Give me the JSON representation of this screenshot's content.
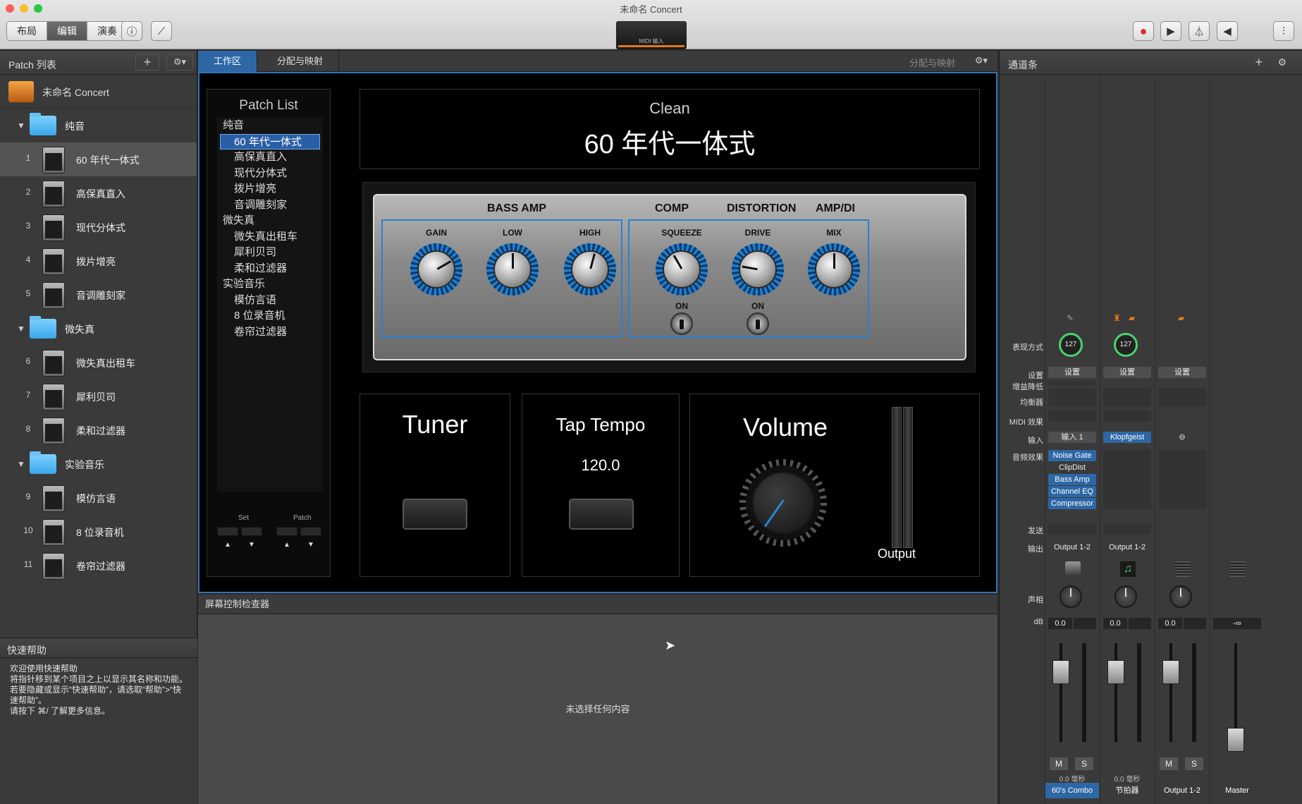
{
  "window": {
    "title": "未命名 Concert"
  },
  "toolbar": {
    "segments": [
      "布局",
      "编辑",
      "演奏"
    ],
    "selected": "编辑",
    "midi_display": "MIDI 输入"
  },
  "left_panel": {
    "title": "Patch 列表",
    "concert_name": "未命名 Concert",
    "sets": [
      {
        "name": "纯音",
        "patches": [
          {
            "num": "1",
            "name": "60 年代一体式"
          },
          {
            "num": "2",
            "name": "高保真直入"
          },
          {
            "num": "3",
            "name": "现代分体式"
          },
          {
            "num": "4",
            "name": "拨片增亮"
          },
          {
            "num": "5",
            "name": "音调雕刻家"
          }
        ]
      },
      {
        "name": "微失真",
        "patches": [
          {
            "num": "6",
            "name": "微失真出租车"
          },
          {
            "num": "7",
            "name": "犀利贝司"
          },
          {
            "num": "8",
            "name": "柔和过滤器"
          }
        ]
      },
      {
        "name": "实验音乐",
        "patches": [
          {
            "num": "9",
            "name": "模仿言语"
          },
          {
            "num": "10",
            "name": "8 位录音机"
          },
          {
            "num": "11",
            "name": "卷帘过滤器"
          }
        ]
      }
    ]
  },
  "quick_help": {
    "title": "快速帮助",
    "text": "欢迎使用快速帮助\n将指针移到某个项目之上以显示其名称和功能。若要隐藏或显示“快速帮助”，请选取“帮助”>“快速帮助”。\n请按下 ⌘/ 了解更多信息。"
  },
  "workspace": {
    "tabs": [
      "工作区",
      "分配与映射"
    ],
    "right_label": "分配与映射",
    "patch_list": {
      "title": "Patch List",
      "items": [
        {
          "type": "set",
          "label": "纯音"
        },
        {
          "type": "patch",
          "label": "60 年代一体式",
          "selected": true
        },
        {
          "type": "patch",
          "label": "高保真直入"
        },
        {
          "type": "patch",
          "label": "现代分体式"
        },
        {
          "type": "patch",
          "label": "拨片增亮"
        },
        {
          "type": "patch",
          "label": "音调雕刻家"
        },
        {
          "type": "set",
          "label": "微失真"
        },
        {
          "type": "patch",
          "label": "微失真出租车"
        },
        {
          "type": "patch",
          "label": "犀利贝司"
        },
        {
          "type": "patch",
          "label": "柔和过滤器"
        },
        {
          "type": "set",
          "label": "实验音乐"
        },
        {
          "type": "patch",
          "label": "模仿言语"
        },
        {
          "type": "patch",
          "label": "8 位录音机"
        },
        {
          "type": "patch",
          "label": "卷帘过滤器"
        }
      ],
      "set_label": "Set",
      "patch_label": "Patch"
    },
    "patch_name": {
      "set": "Clean",
      "patch": "60 年代一体式"
    },
    "amp": {
      "sections": [
        "BASS AMP",
        "COMP",
        "DISTORTION",
        "AMP/DI"
      ],
      "knobs": [
        "GAIN",
        "LOW",
        "HIGH",
        "SQUEEZE",
        "DRIVE",
        "MIX"
      ],
      "switch_label": "ON"
    },
    "tuner": {
      "title": "Tuner"
    },
    "tap_tempo": {
      "title": "Tap Tempo",
      "value": "120.0"
    },
    "volume": {
      "title": "Volume",
      "output_label": "Output"
    }
  },
  "inspector": {
    "title": "屏幕控制检查器",
    "empty_text": "未选择任何内容"
  },
  "channel_strip": {
    "title": "通道条",
    "labels": [
      "表现方式",
      "设置",
      "增益降低",
      "均衡器",
      "MIDI 效果",
      "输入",
      "音频效果",
      "发送",
      "输出",
      "声相",
      "dB"
    ],
    "strips": [
      {
        "velocity": "127",
        "setting": "设置",
        "input": "输入 1",
        "effects": [
          "Noise Gate",
          "ClipDist",
          "Bass Amp",
          "Channel EQ",
          "Compressor"
        ],
        "output": "Output 1-2",
        "db": "0.0",
        "m": "M",
        "s": "S",
        "latency": "0.0 毫秒",
        "name": "60's Combo"
      },
      {
        "velocity": "127",
        "setting": "设置",
        "input": "Klopfgeist",
        "output": "Output 1-2",
        "db": "0.0",
        "latency": "0.0 毫秒",
        "name": "节拍器"
      },
      {
        "setting": "设置",
        "db": "0.0",
        "m": "M",
        "s": "S",
        "name": "Output 1-2"
      },
      {
        "db": "-∞",
        "name": "Master"
      }
    ]
  },
  "colors": {
    "accent": "#2d67a6",
    "knob_ring": "#1e80d6",
    "green": "#4cd26f",
    "record": "#d8302a"
  }
}
